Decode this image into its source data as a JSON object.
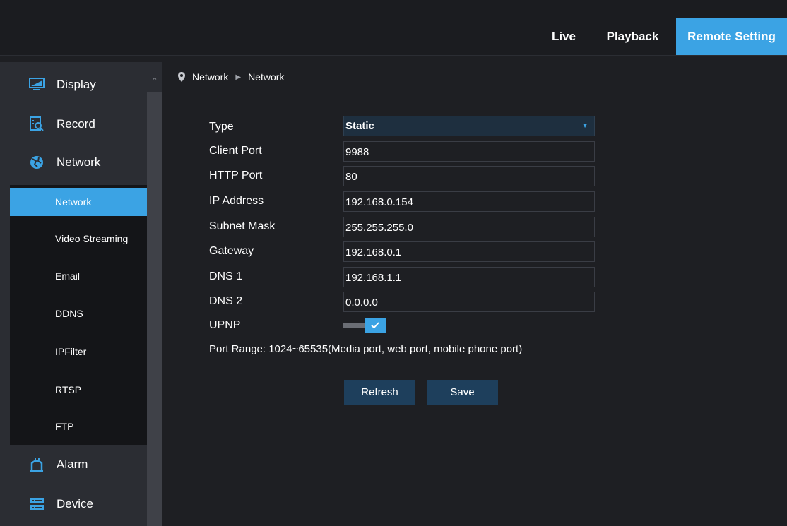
{
  "header": {
    "nav": [
      {
        "label": "Live"
      },
      {
        "label": "Playback"
      },
      {
        "label": "Remote Setting"
      }
    ]
  },
  "sidebar": {
    "main_items": [
      {
        "label": "Display",
        "icon": "monitor-icon"
      },
      {
        "label": "Record",
        "icon": "record-search-icon"
      },
      {
        "label": "Network",
        "icon": "globe-network-icon"
      },
      {
        "label": "Alarm",
        "icon": "alarm-bell-icon"
      },
      {
        "label": "Device",
        "icon": "device-hdd-icon"
      }
    ],
    "sub_items": [
      {
        "label": "Network"
      },
      {
        "label": "Video Streaming"
      },
      {
        "label": "Email"
      },
      {
        "label": "DDNS"
      },
      {
        "label": "IPFilter"
      },
      {
        "label": "RTSP"
      },
      {
        "label": "FTP"
      }
    ],
    "active_sub": "Network"
  },
  "breadcrumb": {
    "level1": "Network",
    "level2": "Network"
  },
  "form": {
    "type": {
      "label": "Type",
      "value": "Static"
    },
    "client_port": {
      "label": "Client Port",
      "value": "9988"
    },
    "http_port": {
      "label": "HTTP Port",
      "value": "80"
    },
    "ip_address": {
      "label": "IP Address",
      "value": "192.168.0.154"
    },
    "subnet_mask": {
      "label": "Subnet Mask",
      "value": "255.255.255.0"
    },
    "gateway": {
      "label": "Gateway",
      "value": "192.168.0.1"
    },
    "dns1": {
      "label": "DNS 1",
      "value": "192.168.1.1"
    },
    "dns2": {
      "label": "DNS 2",
      "value": "0.0.0.0"
    },
    "upnp": {
      "label": "UPNP",
      "enabled": true
    },
    "note": "Port Range: 1024~65535(Media port, web port, mobile phone port)"
  },
  "buttons": {
    "refresh": "Refresh",
    "save": "Save"
  },
  "colors": {
    "accent": "#3ba3e4",
    "button_bg": "#1e3f5c",
    "background": "#1e1f23",
    "sidebar_bg": "#2b2d33",
    "submenu_bg": "#141518"
  }
}
